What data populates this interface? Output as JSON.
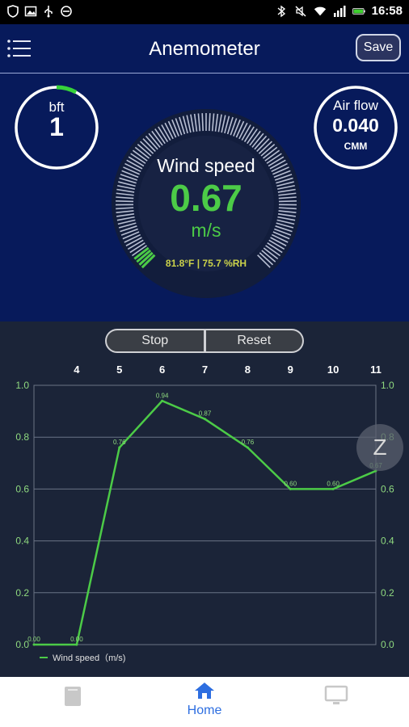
{
  "status_bar": {
    "time": "16:58",
    "left_icons": [
      "shield-icon",
      "image-icon",
      "usb-icon",
      "blocked-icon"
    ],
    "right_icons": [
      "bluetooth-icon",
      "mute-icon",
      "wifi-icon",
      "signal-icon",
      "battery-icon"
    ]
  },
  "header": {
    "title": "Anemometer",
    "save_label": "Save",
    "menu_icon": "menu-icon"
  },
  "gauges": {
    "bft": {
      "label": "bft",
      "value": "1",
      "fraction": 0.08
    },
    "main": {
      "label": "Wind speed",
      "value": "0.67",
      "unit": "m/s",
      "env": "81.8°F | 75.7 %RH",
      "fraction": 0.03
    },
    "airflow": {
      "label": "Air flow",
      "value": "0.040",
      "unit": "CMM"
    }
  },
  "controls": {
    "stop_label": "Stop",
    "reset_label": "Reset"
  },
  "chart_data": {
    "type": "line",
    "x": [
      3,
      4,
      5,
      6,
      7,
      8,
      9,
      10,
      11
    ],
    "x_tick_labels": [
      "4",
      "5",
      "6",
      "7",
      "8",
      "9",
      "10",
      "11"
    ],
    "series": [
      {
        "name": "Wind speed（m/s)",
        "values": [
          0.0,
          0.0,
          0.76,
          0.94,
          0.87,
          0.76,
          0.6,
          0.6,
          0.67
        ],
        "color": "#4ccb47"
      }
    ],
    "point_labels": [
      "0.00",
      "0.00",
      "0.76",
      "0.94",
      "0.87",
      "0.76",
      "0.60",
      "0.60",
      "0.67"
    ],
    "ylim": [
      0.0,
      1.0
    ],
    "y_ticks": [
      "0.0",
      "0.2",
      "0.4",
      "0.6",
      "0.8",
      "1.0"
    ],
    "grid": true,
    "legend": "bottom-left"
  },
  "zoom_badge": {
    "label": "Z"
  },
  "bottom_nav": {
    "items": [
      {
        "icon": "document-icon",
        "label": ""
      },
      {
        "icon": "home-icon",
        "label": "Home"
      },
      {
        "icon": "monitor-icon",
        "label": ""
      }
    ]
  },
  "colors": {
    "header_bg": "#071a5b",
    "chart_bg": "#1b2438",
    "accent_green": "#4ccb47",
    "axis_green": "#8fd97f",
    "env_text": "#cbd24a",
    "nav_active": "#2d6ee0"
  }
}
